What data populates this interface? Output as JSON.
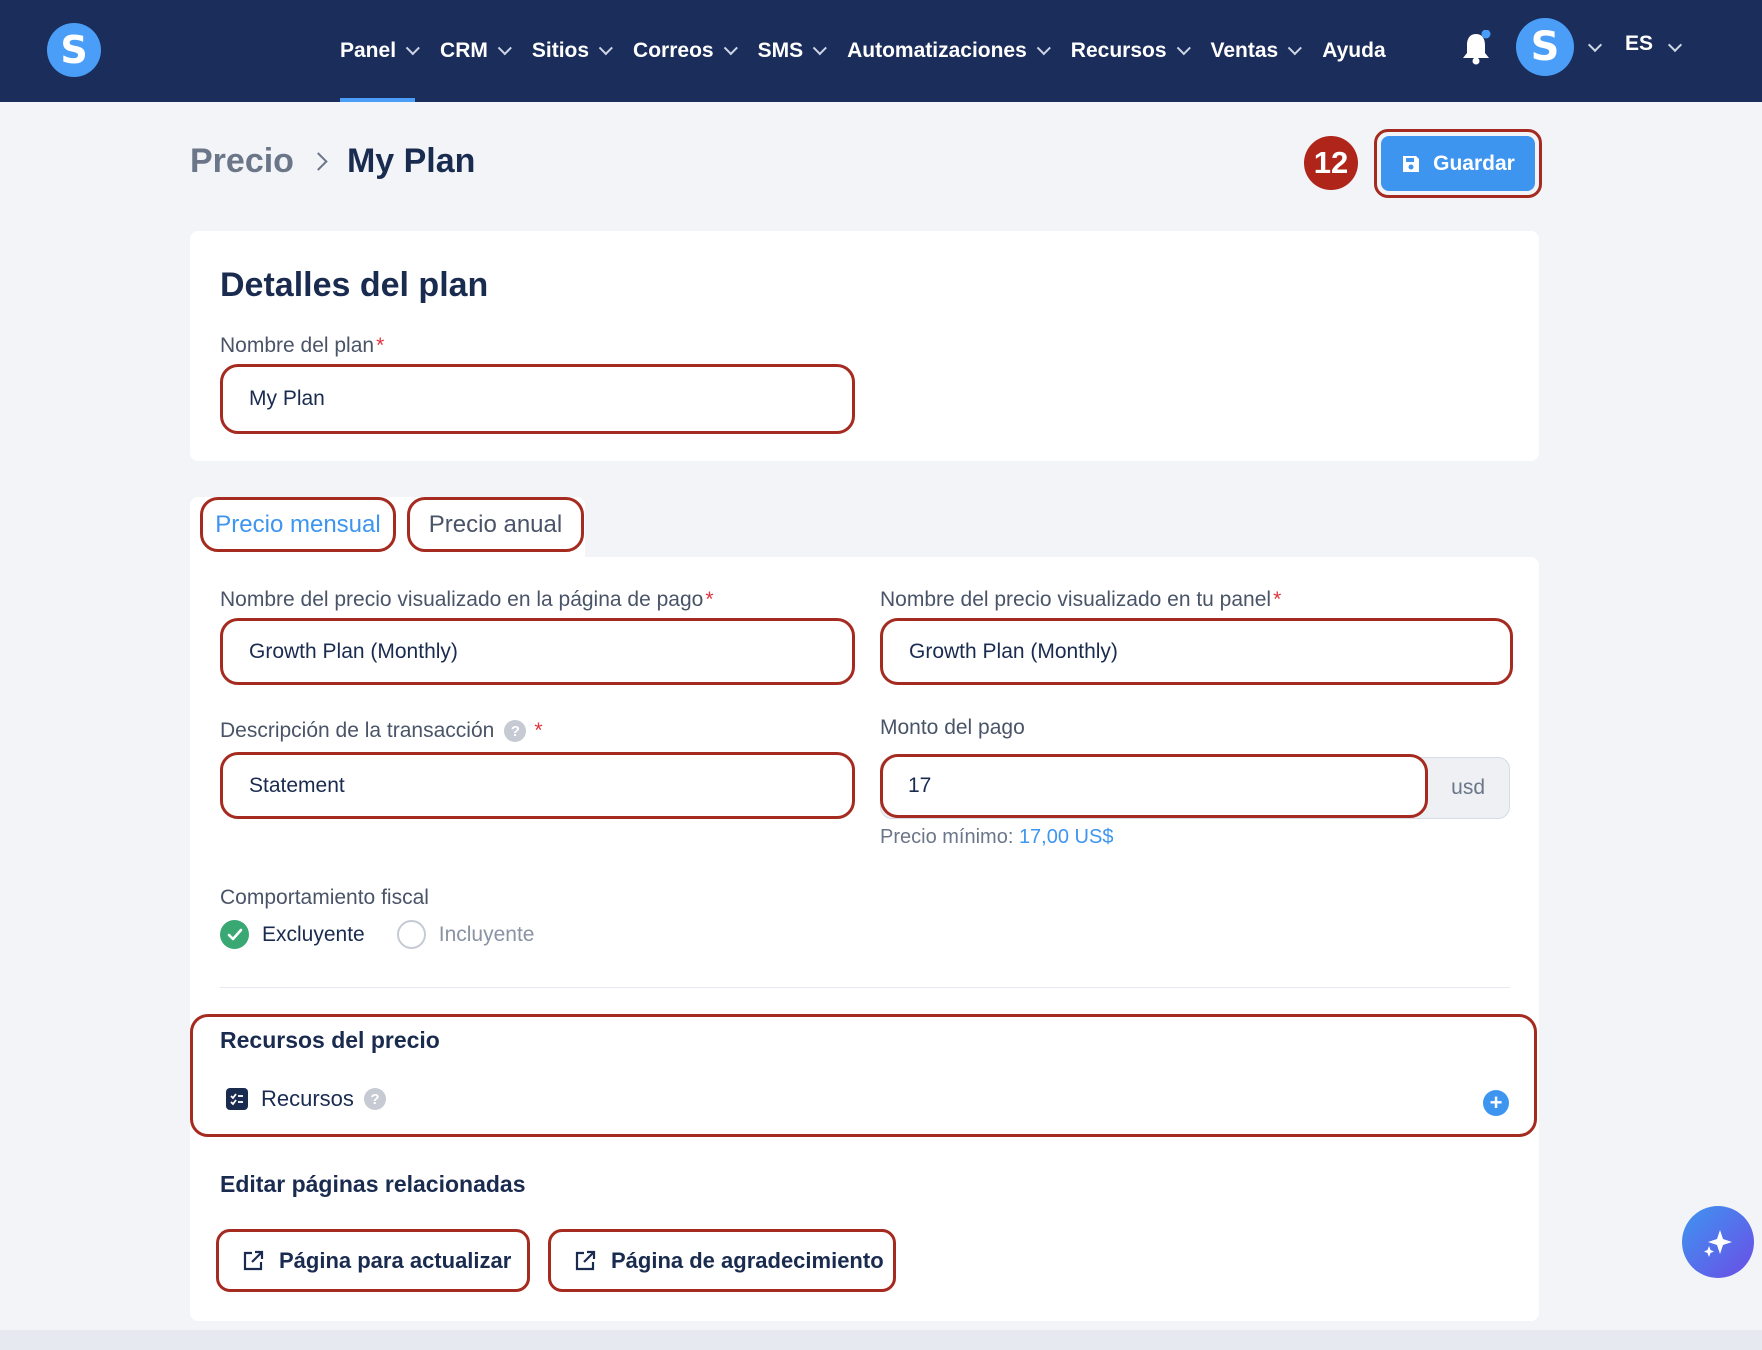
{
  "nav": {
    "logo_letter": "S",
    "items": [
      {
        "label": "Panel",
        "has_menu": true,
        "active": true
      },
      {
        "label": "CRM",
        "has_menu": true
      },
      {
        "label": "Sitios",
        "has_menu": true
      },
      {
        "label": "Correos",
        "has_menu": true
      },
      {
        "label": "SMS",
        "has_menu": true
      },
      {
        "label": "Automatizaciones",
        "has_menu": true
      },
      {
        "label": "Recursos",
        "has_menu": true
      },
      {
        "label": "Ventas",
        "has_menu": true
      },
      {
        "label": "Ayuda",
        "has_menu": false
      }
    ],
    "avatar_letter": "S",
    "language": "ES"
  },
  "header": {
    "breadcrumb_root": "Precio",
    "breadcrumb_current": "My Plan",
    "step_number": "12",
    "save_label": "Guardar"
  },
  "plan_details": {
    "title": "Detalles del plan",
    "name_label": "Nombre del plan",
    "name_value": "My Plan",
    "required_mark": "*"
  },
  "tabs": [
    {
      "label": "Precio mensual",
      "active": true
    },
    {
      "label": "Precio anual",
      "active": false
    }
  ],
  "price_form": {
    "checkout_name_label": "Nombre del precio visualizado en la página de pago",
    "checkout_name_value": "Growth Plan (Monthly)",
    "panel_name_label": "Nombre del precio visualizado en tu panel",
    "panel_name_value": "Growth Plan (Monthly)",
    "statement_label": "Descripción de la transacción",
    "statement_value": "Statement",
    "help_glyph": "?",
    "amount_label": "Monto del pago",
    "amount_value": "17",
    "currency": "usd",
    "min_price_label": "Precio mínimo:",
    "min_price_value": "17,00 US$",
    "tax_label": "Comportamiento fiscal",
    "tax_options": [
      {
        "label": "Excluyente",
        "selected": true
      },
      {
        "label": "Incluyente",
        "selected": false
      }
    ]
  },
  "resources": {
    "title": "Recursos del precio",
    "item_label": "Recursos",
    "add_glyph": "+"
  },
  "related_pages": {
    "title": "Editar páginas relacionadas",
    "upgrade_label": "Página para actualizar",
    "thanks_label": "Página de agradecimiento"
  },
  "colors": {
    "nav_bg": "#1b2d5b",
    "accent": "#3e95f0",
    "highlight": "#a52a1f",
    "success": "#3aa872"
  },
  "icons": [
    "bell-icon",
    "save-icon",
    "help-icon",
    "checklist-icon",
    "plus-circle-icon",
    "external-link-icon",
    "sparkle-icon",
    "check-icon"
  ]
}
